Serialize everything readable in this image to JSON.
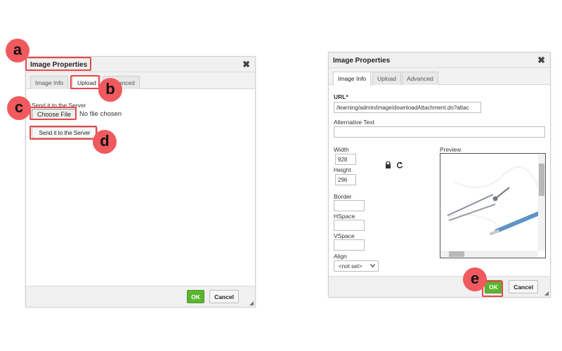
{
  "left_dialog": {
    "title": "Image Properties",
    "close_symbol": "✖",
    "tabs": [
      "Image Info",
      "Upload",
      "Advanced"
    ],
    "upload_label": "Send it to the Server",
    "choose_file_label": "Choose File",
    "no_file_text": "No file chosen",
    "send_button_label": "Send it to the Server",
    "ok_label": "OK",
    "cancel_label": "Cancel"
  },
  "right_dialog": {
    "title": "Image Properties",
    "close_symbol": "✖",
    "tabs": [
      "Image Info",
      "Upload",
      "Advanced"
    ],
    "url_label": "URL*",
    "url_value": "/learning/admin/image/downloadAttachment.do?attac",
    "alt_text_label": "Alternative Text",
    "alt_text_value": "",
    "width_label": "Width",
    "width_value": "928",
    "height_label": "Height",
    "height_value": "296",
    "border_label": "Border",
    "hspace_label": "HSpace",
    "vspace_label": "VSpace",
    "align_label": "Align",
    "align_value": "<not set>",
    "preview_label": "Preview",
    "lock_icon": "lock-icon",
    "reset_icon": "reset-size-icon",
    "ok_label": "OK",
    "cancel_label": "Cancel"
  },
  "markers": {
    "a": "a",
    "b": "b",
    "c": "c",
    "d": "d",
    "e": "e"
  },
  "colors": {
    "marker": "#f05a5e",
    "highlight": "#e8474c",
    "ok_button": "#5cb531"
  }
}
